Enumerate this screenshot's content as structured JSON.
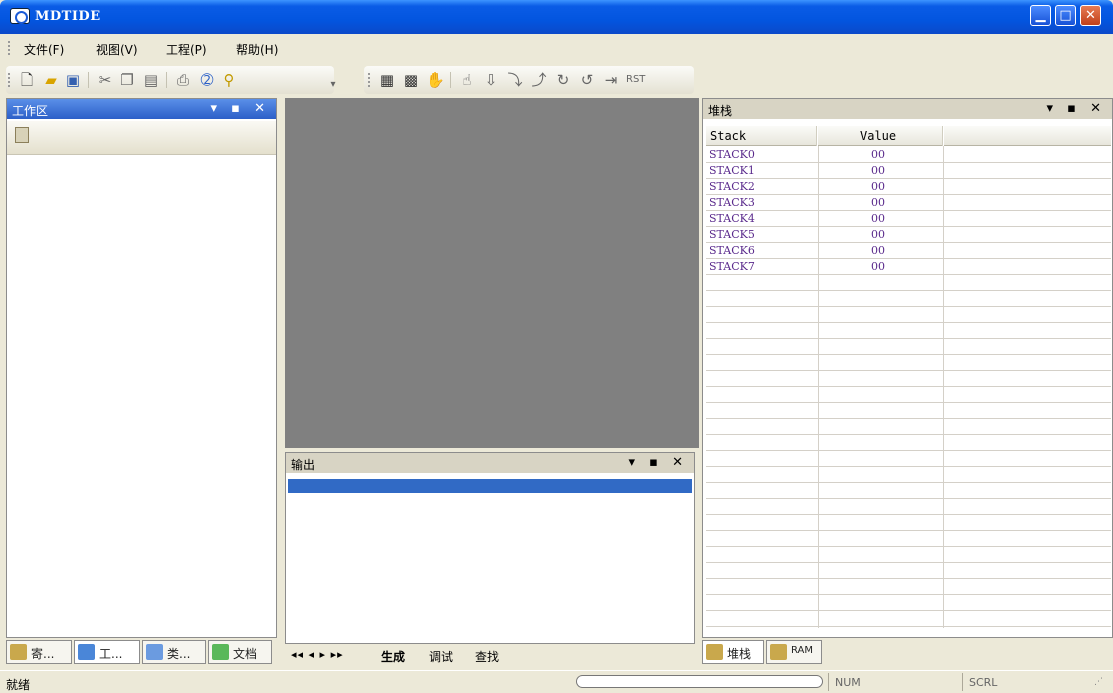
{
  "window": {
    "title": "MDTIDE",
    "minimize": "_",
    "maximize": "□",
    "close": "X"
  },
  "menu": {
    "items": [
      {
        "label": "文件(F)"
      },
      {
        "label": "视图(V)"
      },
      {
        "label": "工程(P)"
      },
      {
        "label": "帮助(H)"
      }
    ]
  },
  "toolbar_std": {
    "icons": [
      "new-file-icon",
      "open-folder-icon",
      "save-icon",
      "cut-icon",
      "copy-icon",
      "paste-icon",
      "print-icon",
      "help-icon",
      "find-icon"
    ]
  },
  "toolbar_dbg": {
    "icons": [
      "build-icon",
      "rebuild-icon",
      "stop-icon",
      "breakpoint-icon",
      "step-icon",
      "step-over-icon",
      "step-out-icon",
      "run-to-cursor-icon",
      "go-icon",
      "halt-icon",
      "reset-icon"
    ]
  },
  "workspace": {
    "title": "工作区",
    "buttons": "▾ ▪ ✕"
  },
  "output": {
    "title": "输出",
    "buttons": "▾ ▪ ✕",
    "tabs": [
      "生成",
      "调试",
      "查找"
    ],
    "nav": "◂◂ ◂ ▸ ▸▸"
  },
  "left_tabs": [
    {
      "label": "寄...",
      "icon": "register-icon"
    },
    {
      "label": "工...",
      "icon": "project-icon"
    },
    {
      "label": "类...",
      "icon": "class-icon"
    },
    {
      "label": "文档",
      "icon": "document-icon"
    }
  ],
  "stack": {
    "title": "堆栈",
    "buttons": "▾ ▪ ✕",
    "columns": [
      "Stack",
      "Value"
    ],
    "rows": [
      {
        "name": "STACK0",
        "value": "00"
      },
      {
        "name": "STACK1",
        "value": "00"
      },
      {
        "name": "STACK2",
        "value": "00"
      },
      {
        "name": "STACK3",
        "value": "00"
      },
      {
        "name": "STACK4",
        "value": "00"
      },
      {
        "name": "STACK5",
        "value": "00"
      },
      {
        "name": "STACK6",
        "value": "00"
      },
      {
        "name": "STACK7",
        "value": "00"
      }
    ],
    "tabs": [
      {
        "label": "堆栈",
        "icon": "stack-icon"
      },
      {
        "label": "RAM",
        "icon": "ram-icon"
      }
    ]
  },
  "status": {
    "text": "就绪",
    "num": "NUM",
    "scrl": "SCRL"
  }
}
